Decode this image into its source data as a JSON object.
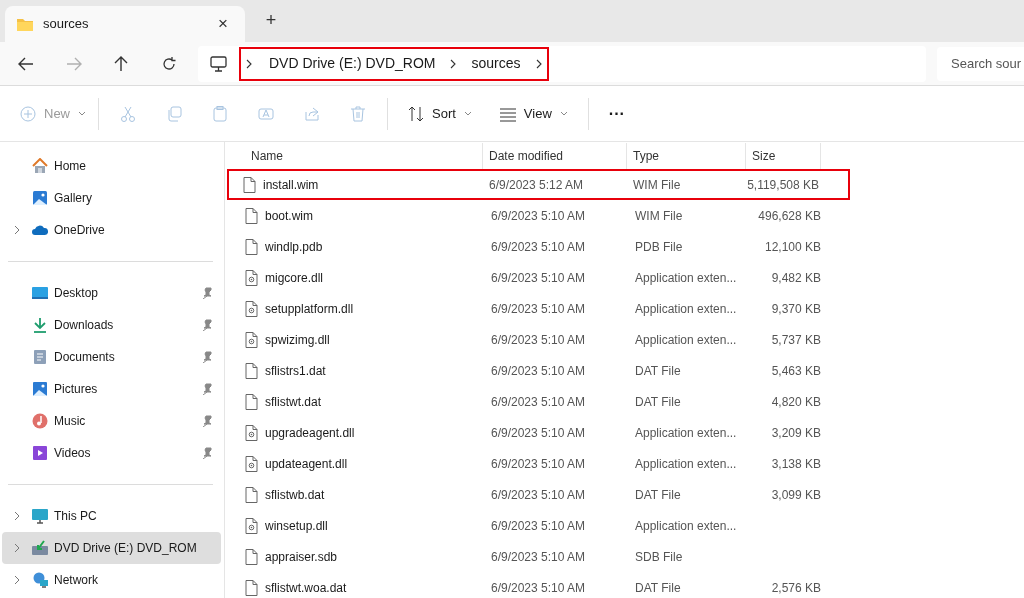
{
  "tab": {
    "title": "sources",
    "close": "×",
    "new_tab": "+"
  },
  "address": {
    "crumbs": [
      "DVD Drive (E:) DVD_ROM",
      "sources"
    ],
    "highlighted": true,
    "search_placeholder": "Search sour"
  },
  "toolbar": [
    {
      "kind": "new",
      "label": "New",
      "disabled": true
    },
    {
      "kind": "cut",
      "disabled": true
    },
    {
      "kind": "copy",
      "disabled": true
    },
    {
      "kind": "paste",
      "disabled": true
    },
    {
      "kind": "rename",
      "disabled": true
    },
    {
      "kind": "share",
      "disabled": true
    },
    {
      "kind": "delete",
      "disabled": true
    },
    {
      "kind": "sort",
      "label": "Sort",
      "disabled": false
    },
    {
      "kind": "view",
      "label": "View",
      "disabled": false
    },
    {
      "kind": "more",
      "label": "···",
      "disabled": false
    }
  ],
  "sidebar": [
    {
      "items": [
        {
          "kind": "home",
          "label": "Home",
          "expandable": false,
          "pinned": false,
          "selected": false
        },
        {
          "kind": "gallery",
          "label": "Gallery",
          "expandable": false,
          "pinned": false,
          "selected": false
        },
        {
          "kind": "onedrive",
          "label": "OneDrive",
          "expandable": true,
          "pinned": false,
          "selected": false
        }
      ]
    },
    {
      "items": [
        {
          "kind": "desktop",
          "label": "Desktop",
          "expandable": false,
          "pinned": true,
          "selected": false
        },
        {
          "kind": "downloads",
          "label": "Downloads",
          "expandable": false,
          "pinned": true,
          "selected": false
        },
        {
          "kind": "documents",
          "label": "Documents",
          "expandable": false,
          "pinned": true,
          "selected": false
        },
        {
          "kind": "pictures",
          "label": "Pictures",
          "expandable": false,
          "pinned": true,
          "selected": false
        },
        {
          "kind": "music",
          "label": "Music",
          "expandable": false,
          "pinned": true,
          "selected": false
        },
        {
          "kind": "videos",
          "label": "Videos",
          "expandable": false,
          "pinned": true,
          "selected": false
        }
      ]
    },
    {
      "items": [
        {
          "kind": "pc",
          "label": "This PC",
          "expandable": true,
          "pinned": false,
          "selected": false
        },
        {
          "kind": "dvd",
          "label": "DVD Drive (E:) DVD_ROM",
          "expandable": true,
          "pinned": false,
          "selected": true
        },
        {
          "kind": "network",
          "label": "Network",
          "expandable": true,
          "pinned": false,
          "selected": false
        }
      ]
    }
  ],
  "table": {
    "columns": [
      "Name",
      "Date modified",
      "Type",
      "Size"
    ],
    "rows": [
      {
        "kind": "blank",
        "name": "install.wim",
        "date": "6/9/2023 5:12 AM",
        "type": "WIM File",
        "size": "5,119,508 KB",
        "highlighted": true
      },
      {
        "kind": "blank",
        "name": "boot.wim",
        "date": "6/9/2023 5:10 AM",
        "type": "WIM File",
        "size": "496,628 KB",
        "highlighted": false
      },
      {
        "kind": "blank",
        "name": "windlp.pdb",
        "date": "6/9/2023 5:10 AM",
        "type": "PDB File",
        "size": "12,100 KB",
        "highlighted": false
      },
      {
        "kind": "dll",
        "name": "migcore.dll",
        "date": "6/9/2023 5:10 AM",
        "type": "Application exten...",
        "size": "9,482 KB",
        "highlighted": false
      },
      {
        "kind": "dll",
        "name": "setupplatform.dll",
        "date": "6/9/2023 5:10 AM",
        "type": "Application exten...",
        "size": "9,370 KB",
        "highlighted": false
      },
      {
        "kind": "dll",
        "name": "spwizimg.dll",
        "date": "6/9/2023 5:10 AM",
        "type": "Application exten...",
        "size": "5,737 KB",
        "highlighted": false
      },
      {
        "kind": "blank",
        "name": "sflistrs1.dat",
        "date": "6/9/2023 5:10 AM",
        "type": "DAT File",
        "size": "5,463 KB",
        "highlighted": false
      },
      {
        "kind": "blank",
        "name": "sflistwt.dat",
        "date": "6/9/2023 5:10 AM",
        "type": "DAT File",
        "size": "4,820 KB",
        "highlighted": false
      },
      {
        "kind": "dll",
        "name": "upgradeagent.dll",
        "date": "6/9/2023 5:10 AM",
        "type": "Application exten...",
        "size": "3,209 KB",
        "highlighted": false
      },
      {
        "kind": "dll",
        "name": "updateagent.dll",
        "date": "6/9/2023 5:10 AM",
        "type": "Application exten...",
        "size": "3,138 KB",
        "highlighted": false
      },
      {
        "kind": "blank",
        "name": "sflistwb.dat",
        "date": "6/9/2023 5:10 AM",
        "type": "DAT File",
        "size": "3,099 KB",
        "highlighted": false
      },
      {
        "kind": "dll",
        "name": "winsetup.dll",
        "date": "6/9/2023 5:10 AM",
        "type": "Application exten...",
        "highlighted": false
      },
      {
        "kind": "blank",
        "name": "appraiser.sdb",
        "date": "6/9/2023 5:10 AM",
        "type": "SDB File",
        "highlighted": false
      },
      {
        "kind": "blank",
        "name": "sflistwt.woa.dat",
        "date": "6/9/2023 5:10 AM",
        "type": "DAT File",
        "size": "2,576 KB",
        "highlighted": false
      }
    ]
  }
}
